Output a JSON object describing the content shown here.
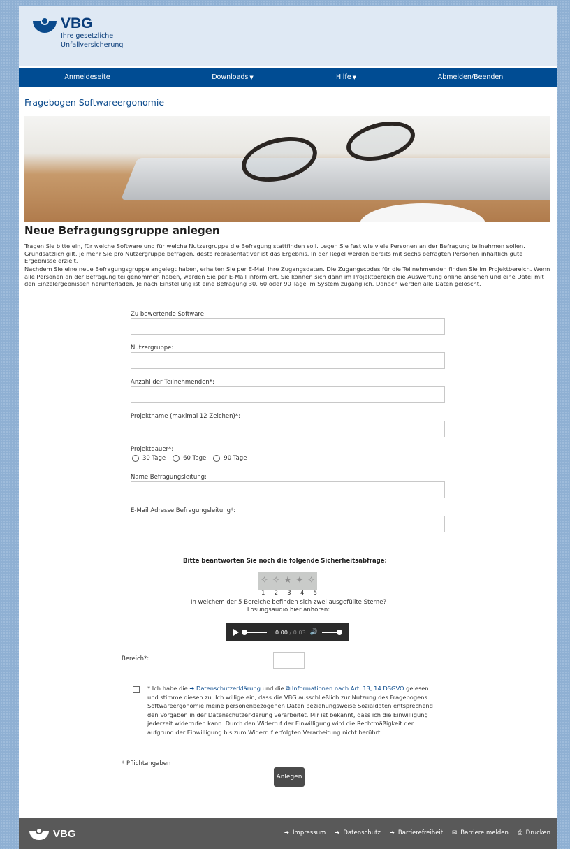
{
  "header": {
    "logo_name": "VBG",
    "logo_sub_1": "Ihre gesetzliche",
    "logo_sub_2": "Unfallversicherung"
  },
  "nav": {
    "items": [
      {
        "label": "Anmeldeseite",
        "icon": ""
      },
      {
        "label": "Downloads",
        "icon": "caret-down"
      },
      {
        "label": "Hilfe",
        "icon": "caret-down"
      },
      {
        "label": "Abmelden/Beenden",
        "icon": ""
      }
    ]
  },
  "section_title": "Fragebogen Softwareergonomie",
  "heading": "Neue Befragungsgruppe anlegen",
  "intro": {
    "p1": "Tragen Sie bitte ein, für welche Software und für welche Nutzergruppe die Befragung stattfinden soll. Legen Sie fest wie viele Personen an der Befragung teilnehmen sollen. Grundsätzlich gilt, je mehr Sie pro Nutzergruppe befragen, desto repräsentativer ist das Ergebnis. In der Regel werden bereits mit sechs befragten Personen inhaltlich gute Ergebnisse erzielt.",
    "p2": "Nachdem Sie eine neue Befragungsgruppe angelegt haben, erhalten Sie per E-Mail Ihre Zugangsdaten. Die Zugangscodes für die Teilnehmenden finden Sie im Projektbereich. Wenn alle Personen an der Befragung teilgenommen haben, werden Sie per E-Mail informiert. Sie können sich dann im Projektbereich die Auswertung online ansehen und eine Datei mit den Einzelergebnissen herunterladen. Je nach Einstellung ist eine Befragung 30, 60 oder 90 Tage im System zugänglich. Danach werden alle Daten gelöscht."
  },
  "form": {
    "software_label": "Zu bewertende Software:",
    "software_value": "",
    "nutzergruppe_label": "Nutzergruppe:",
    "nutzergruppe_value": "",
    "anzahl_label": "Anzahl der Teilnehmenden*:",
    "anzahl_value": "",
    "projektname_label": "Projektname (maximal 12 Zeichen)*:",
    "projektname_value": "",
    "projektdauer_label": "Projektdauer*:",
    "projektdauer_options": [
      "30 Tage",
      "60 Tage",
      "90 Tage"
    ],
    "leitung_label": "Name Befragungsleitung:",
    "leitung_value": "",
    "email_label": "E-Mail Adresse Befragungsleitung*:",
    "email_value": ""
  },
  "captcha": {
    "question": "Bitte beantworten Sie noch die folgende Sicherheitsabfrage:",
    "numbers": [
      "1",
      "2",
      "3",
      "4",
      "5"
    ],
    "instruction": "In welchem der 5 Bereiche befinden sich zwei ausgefüllte Sterne?",
    "audio_hint": "Lösungsaudio hier anhören:",
    "audio_time_current": "0:00",
    "audio_time_total": "/ 0:03",
    "bereich_label": "Bereich*:",
    "bereich_value": ""
  },
  "consent": {
    "prefix": "* Ich habe die ",
    "link1": "Datenschutzerklärung",
    "middle": " und die ",
    "link2": "Informationen nach Art. 13, 14 DSGVO",
    "suffix": " gelesen und stimme diesen zu. Ich willige ein, dass die VBG ausschließlich zur Nutzung des Fragebogens Softwareergonomie meine personenbezogenen Daten beziehungsweise Sozialdaten entsprechend den Vorgaben in der Datenschutzerklärung verarbeitet. Mir ist bekannt, dass ich die Einwilligung jederzeit widerrufen kann. Durch den Widerruf der Einwilligung wird die Rechtmäßigkeit der aufgrund der Einwilligung bis zum Widerruf erfolgten Verarbeitung nicht berührt."
  },
  "pflicht": "* Pflichtangaben",
  "submit_label": "Anlegen",
  "footer": {
    "logo": "VBG",
    "links": [
      {
        "label": "Impressum",
        "icon": "arrow-right-icon"
      },
      {
        "label": "Datenschutz",
        "icon": "arrow-right-icon"
      },
      {
        "label": "Barrierefreiheit",
        "icon": "arrow-right-icon"
      },
      {
        "label": "Barriere melden",
        "icon": "mail-icon"
      },
      {
        "label": "Drucken",
        "icon": "print-icon"
      }
    ]
  }
}
